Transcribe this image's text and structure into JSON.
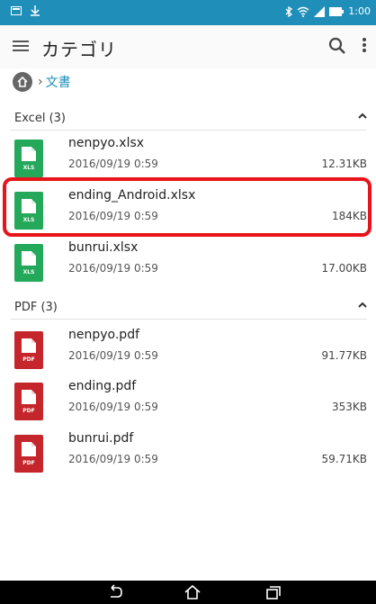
{
  "status_bar": {
    "time": "1:00"
  },
  "app_bar": {
    "title": "カテゴリ"
  },
  "breadcrumb": {
    "current": "文書"
  },
  "sections": [
    {
      "label": "Excel (3)",
      "files": [
        {
          "name": "nenpyo.xlsx",
          "date": "2016/09/19 0:59",
          "size": "12.31KB",
          "tag": "XLS"
        },
        {
          "name": "ending_Android.xlsx",
          "date": "2016/09/19 0:59",
          "size": "184KB",
          "tag": "XLS"
        },
        {
          "name": "bunrui.xlsx",
          "date": "2016/09/19 0:59",
          "size": "17.00KB",
          "tag": "XLS"
        }
      ]
    },
    {
      "label": "PDF (3)",
      "files": [
        {
          "name": "nenpyo.pdf",
          "date": "2016/09/19 0:59",
          "size": "91.77KB",
          "tag": "PDF"
        },
        {
          "name": "ending.pdf",
          "date": "2016/09/19 0:59",
          "size": "353KB",
          "tag": "PDF"
        },
        {
          "name": "bunrui.pdf",
          "date": "2016/09/19 0:59",
          "size": "59.71KB",
          "tag": "PDF"
        }
      ]
    }
  ],
  "colors": {
    "accent": "#1f8fb9",
    "xls": "#24a85a",
    "pdf": "#c4262b",
    "highlight": "#e8141b"
  }
}
